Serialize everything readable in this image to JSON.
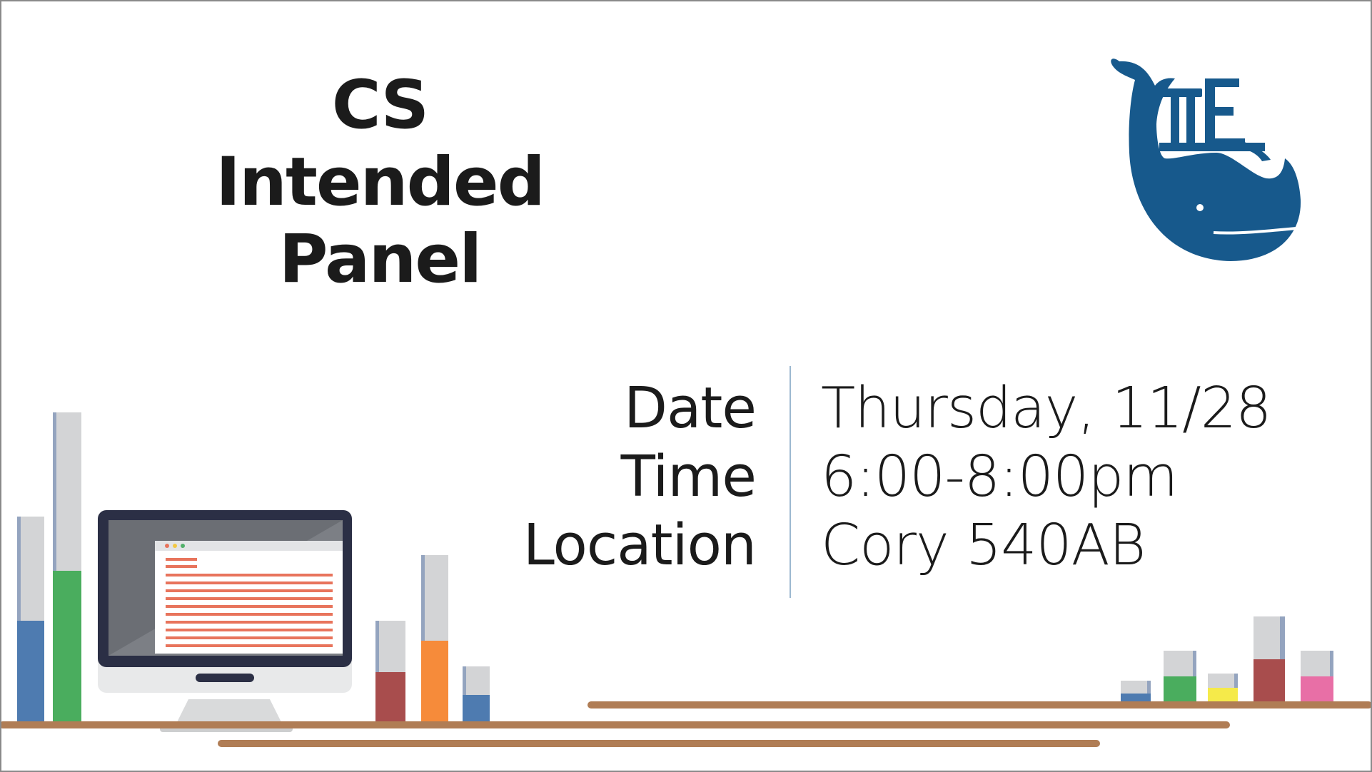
{
  "title": {
    "line1": "CS Intended",
    "line2": "Panel"
  },
  "details": {
    "date_label": "Date",
    "date_value": "Thursday, 11/28",
    "time_label": "Time",
    "time_value": "6:00-8:00pm",
    "location_label": "Location",
    "location_value": "Cory 540AB"
  },
  "logo": {
    "icon": "whale-logo-icon",
    "letters": "TT E",
    "color": "#17598c"
  },
  "colors": {
    "shelf": "#b07d55",
    "bar_bg": "#d3d4d6",
    "bar_edge": "#94a4bf",
    "blue": "#4e7bb0",
    "green": "#4aad5e",
    "red": "#a84d4d",
    "orange": "#f68b3a",
    "yellow": "#f5ea4a",
    "pink": "#e86fa6",
    "text_line": "#e8745c"
  }
}
